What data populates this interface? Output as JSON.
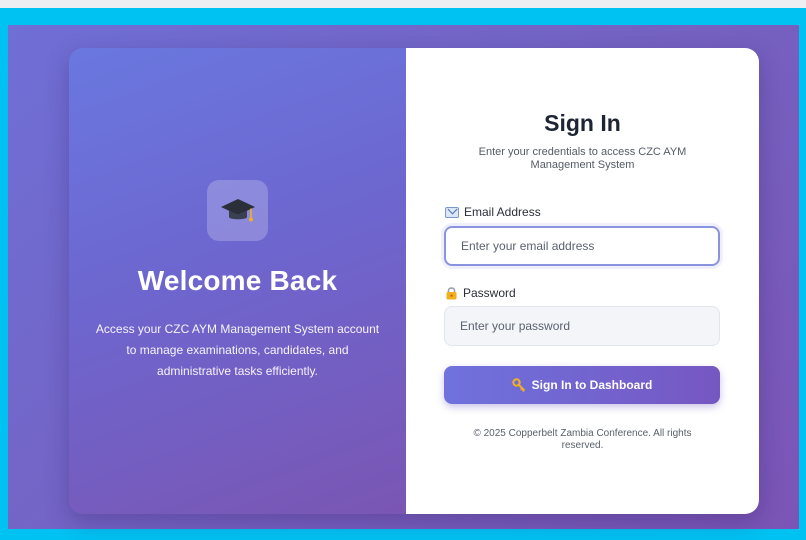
{
  "left_panel": {
    "heading": "Welcome Back",
    "description": "Access your CZC AYM Management System account to manage examinations, candidates, and administrative tasks efficiently.",
    "logo_icon": "graduation-cap-icon"
  },
  "form": {
    "title": "Sign In",
    "subtitle": "Enter your credentials to access CZC AYM Management System",
    "email": {
      "label": "Email Address",
      "icon": "envelope-icon",
      "placeholder": "Enter your email address",
      "value": ""
    },
    "password": {
      "label": "Password",
      "icon": "lock-icon",
      "placeholder": "Enter your password",
      "value": ""
    },
    "submit_label": "Sign In to Dashboard",
    "submit_icon": "key-icon",
    "footer": "© 2025 Copperbelt Zambia Conference. All rights reserved."
  },
  "colors": {
    "frame": "#00c2f2",
    "accent": "#7563cf",
    "button_start": "#6f72dd",
    "button_end": "#7657c2"
  }
}
